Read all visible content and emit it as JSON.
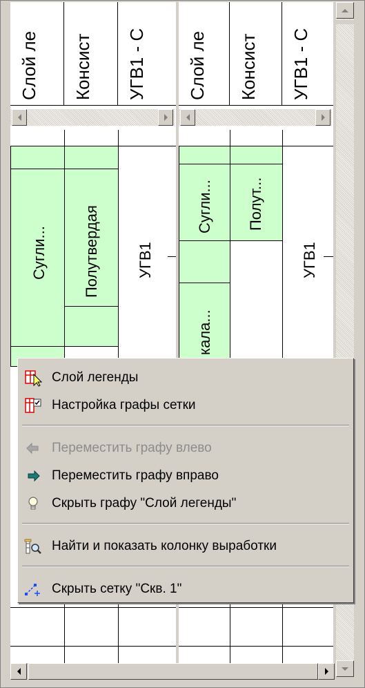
{
  "columns": {
    "left": [
      "Слой ле",
      "Консист",
      "УГВ1 - С"
    ],
    "right": [
      "Слой ле",
      "Консист",
      "УГВ1 - С"
    ]
  },
  "cells": {
    "left_soil": "Сугли...",
    "left_consistency": "Полутвердая",
    "left_ugv": "УГВ1",
    "right_soil": "Сугли...",
    "right_consistency": "Полут...",
    "right_ugv": "УГВ1",
    "right_lower_soil": "кала..."
  },
  "menu": {
    "items": [
      {
        "label": "Слой легенды",
        "icon": "legend-layer-icon",
        "enabled": true
      },
      {
        "label": "Настройка графы сетки",
        "icon": "grid-column-settings-icon",
        "enabled": true
      },
      {
        "label": "Переместить графу влево",
        "icon": "arrow-left-icon",
        "enabled": false
      },
      {
        "label": "Переместить графу вправо",
        "icon": "arrow-right-icon",
        "enabled": true
      },
      {
        "label": "Скрыть графу \"Слой легенды\"",
        "icon": "lightbulb-icon",
        "enabled": true
      },
      {
        "label": "Найти и показать колонку выработки",
        "icon": "find-column-icon",
        "enabled": true
      },
      {
        "label": "Скрыть сетку \"Скв. 1\"",
        "icon": "hide-grid-icon",
        "enabled": true
      }
    ]
  },
  "colors": {
    "green_fill": "#ccffcc",
    "window_bg": "#d4d0c8",
    "disabled_text": "#8c8c8c"
  }
}
